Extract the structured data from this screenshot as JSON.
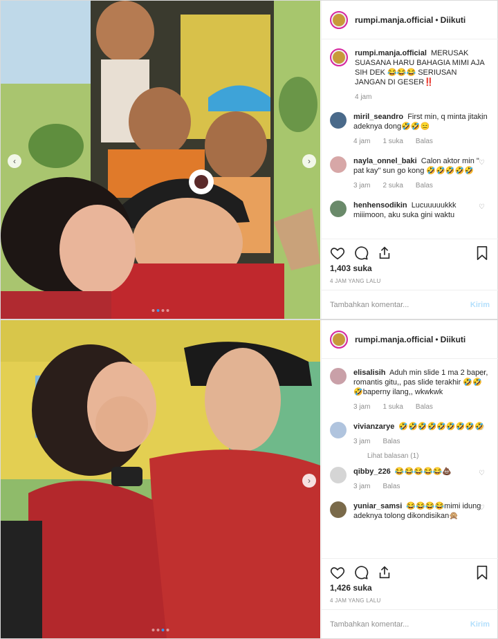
{
  "account": "rumpi.manja.official",
  "follow_state": "Diikuti",
  "separator": "•",
  "posts": [
    {
      "caption": {
        "user": "rumpi.manja.official",
        "text": "MERUSAK SUASANA HARU BAHAGIA MIMI AJA SIH DEK 😂😂😂 SERIUSAN JANGAN DI GESER‼️",
        "time": "4 jam"
      },
      "comments": [
        {
          "user": "miril_seandro",
          "text": "First min, q minta jitakin adeknya dong🤣🤣😑",
          "time": "4 jam",
          "likes": "1 suka",
          "reply": "Balas"
        },
        {
          "user": "nayla_onnel_baki",
          "text": "Calon aktor min \" pat kay\" sun go kong 🤣🤣🤣🤣🤣",
          "time": "3 jam",
          "likes": "2 suka",
          "reply": "Balas"
        },
        {
          "user": "henhensodikin",
          "text": "Lucuuuuukkk miiimoon, aku suka gini waktu",
          "time": "",
          "likes": "",
          "reply": ""
        }
      ],
      "likes": "1,403 suka",
      "ago": "4 JAM YANG LALU",
      "add_comment_placeholder": "Tambahkan komentar...",
      "post_label": "Kirim"
    },
    {
      "caption": null,
      "comments": [
        {
          "user": "elisalisih",
          "text": "Aduh min slide 1 ma 2 baper, romantis gitu,, pas slide terakhir 🤣🤣🤣baperny ilang,, wkwkwk",
          "time": "3 jam",
          "likes": "1 suka",
          "reply": "Balas"
        },
        {
          "user": "vivianzarye",
          "text": "🤣🤣🤣🤣🤣🤣🤣🤣🤣",
          "time": "3 jam",
          "likes": "",
          "reply": "Balas",
          "view_replies": "Lihat balasan (1)"
        },
        {
          "user": "qibby_226",
          "text": "😂😂😂😂😂💩",
          "time": "3 jam",
          "likes": "",
          "reply": "Balas"
        },
        {
          "user": "yuniar_samsi",
          "text": "😂😂😂😂mimi idung adeknya tolong dikondisikan🙊",
          "time": "",
          "likes": "",
          "reply": ""
        }
      ],
      "likes": "1,426 suka",
      "ago": "4 JAM YANG LALU",
      "add_comment_placeholder": "Tambahkan komentar...",
      "post_label": "Kirim"
    }
  ],
  "icons": [
    "heart-icon",
    "comment-icon",
    "share-icon",
    "bookmark-icon",
    "chevron-left-icon",
    "chevron-right-icon"
  ],
  "colors": {
    "brand_ring": "#d6249f",
    "muted": "#8e8e8e",
    "post_btn": "#b2dffc",
    "dot_active": "#3897f0"
  }
}
